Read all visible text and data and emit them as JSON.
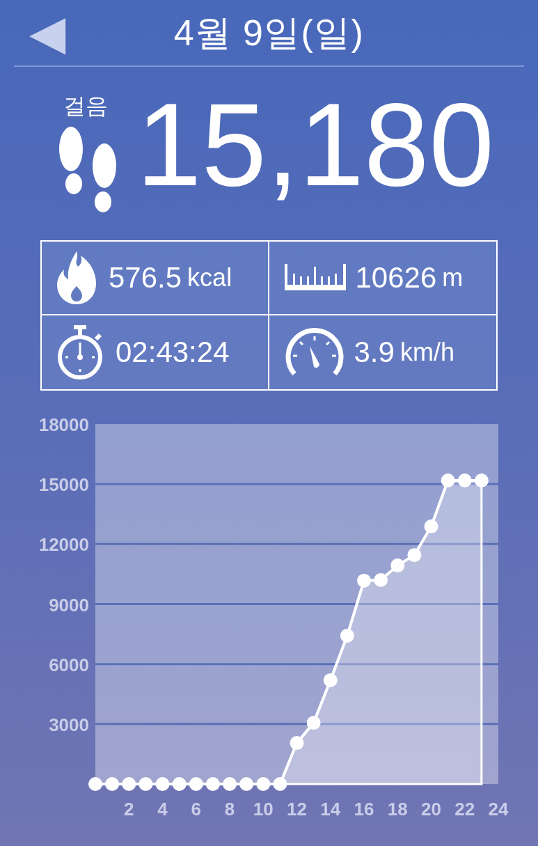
{
  "header": {
    "back": "◀",
    "title": "4월 9일(일)"
  },
  "steps": {
    "label": "걸음",
    "value": "15,180"
  },
  "stats": [
    {
      "kind": "calories",
      "value": "576.5",
      "unit": "kcal"
    },
    {
      "kind": "distance",
      "value": "10626",
      "unit": "m"
    },
    {
      "kind": "duration",
      "value": "02:43:24"
    },
    {
      "kind": "speed",
      "value": "3.9",
      "unit": "km/h"
    }
  ],
  "chart_data": {
    "type": "area",
    "x": [
      0,
      1,
      2,
      3,
      4,
      5,
      6,
      7,
      8,
      9,
      10,
      11,
      12,
      13,
      14,
      15,
      16,
      17,
      18,
      19,
      20,
      21,
      22,
      23
    ],
    "series": [
      {
        "color": "#ffffff",
        "values": [
          0,
          0,
          0,
          0,
          0,
          0,
          0,
          0,
          0,
          0,
          0,
          0,
          2050,
          3060,
          5190,
          7420,
          10170,
          10200,
          10930,
          11450,
          12880,
          15180,
          15180,
          15180
        ]
      }
    ],
    "grid": true,
    "xlim": [
      0,
      24
    ],
    "ylim": [
      0,
      18000
    ],
    "xticks": [
      2,
      4,
      6,
      8,
      10,
      12,
      14,
      16,
      18,
      20,
      22,
      24
    ],
    "yticks": [
      3000,
      6000,
      9000,
      12000,
      15000,
      18000
    ]
  }
}
